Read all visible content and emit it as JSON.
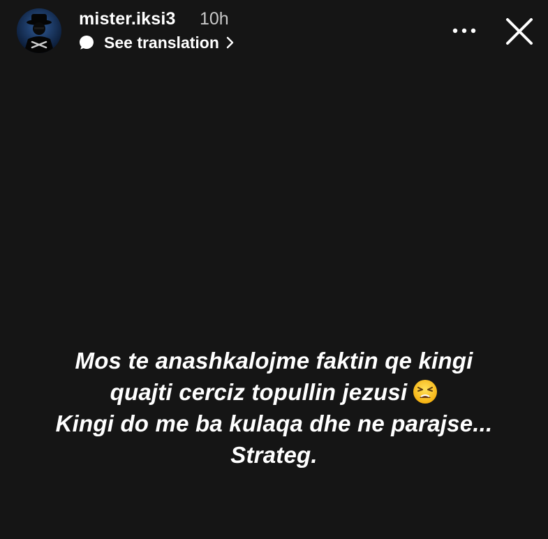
{
  "story": {
    "background_color": "#151515",
    "header": {
      "username": "mister.iksi3",
      "timestamp": "10h",
      "translation_label": "See translation",
      "avatar_icon": "masked-figure-avatar-icon",
      "more_icon": "more-horizontal-icon",
      "close_icon": "close-icon"
    },
    "caption": {
      "line1": "Mos te anashkalojme faktin qe kingi",
      "line2": "quajti cerciz topullin jezusi",
      "line2_emoji": "tired-face-emoji-icon",
      "line3": "Kingi do me ba kulaqa dhe ne parajse...",
      "line4": "Strateg."
    }
  }
}
